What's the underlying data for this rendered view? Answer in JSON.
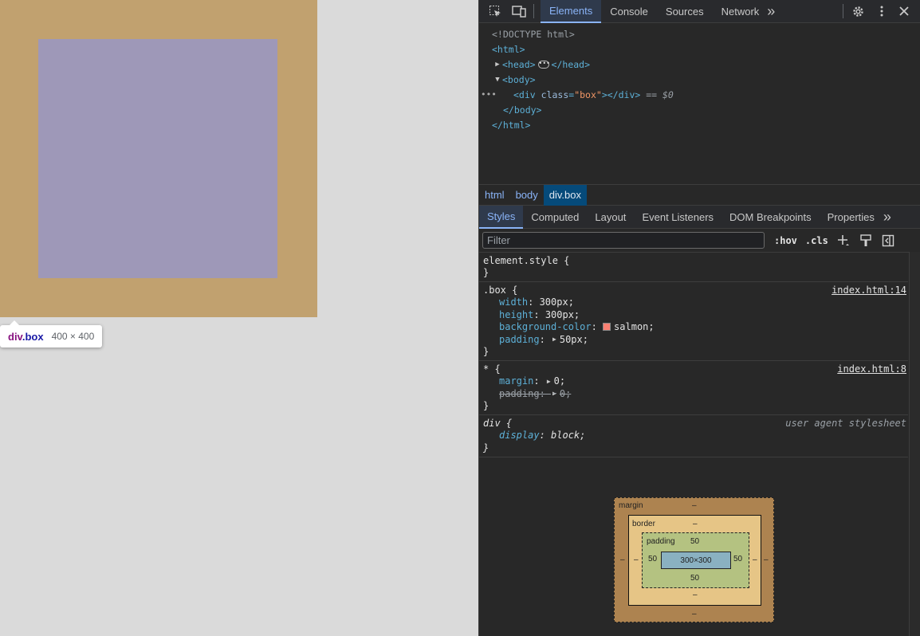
{
  "page": {
    "tooltip": {
      "tag": "div",
      "class_name": ".box",
      "size": "400 × 400"
    }
  },
  "devtools": {
    "toolbar": {
      "tabs": [
        "Elements",
        "Console",
        "Sources",
        "Network"
      ],
      "active_tab": "Elements",
      "more_tabs": "»"
    },
    "dom": {
      "doctype": "<!DOCTYPE html>",
      "html_open": "<html>",
      "head_open": "<head>",
      "head_close": "</head>",
      "body_open": "<body>",
      "div_open": "<div",
      "div_attr": "class",
      "div_attr_val": "\"box\"",
      "div_close": "></div>",
      "selected_marker": "== $0",
      "body_close": "</body>",
      "html_close": "</html>",
      "row_ellipsis": "•••"
    },
    "breadcrumbs": [
      "html",
      "body",
      "div.box"
    ],
    "subtabs": [
      "Styles",
      "Computed",
      "Layout",
      "Event Listeners",
      "DOM Breakpoints",
      "Properties"
    ],
    "filter": {
      "placeholder": "Filter",
      "hov": ":hov",
      "cls": ".cls"
    },
    "rules": {
      "element_style": {
        "selector": "element.style {",
        "close": "}"
      },
      "box": {
        "selector": ".box {",
        "source": "index.html:14",
        "decls": [
          {
            "prop": "width",
            "value": "300px;"
          },
          {
            "prop": "height",
            "value": "300px;"
          },
          {
            "prop": "background-color",
            "value": "salmon;"
          },
          {
            "prop": "padding",
            "value": "50px;"
          }
        ],
        "close": "}"
      },
      "universal": {
        "selector": "* {",
        "source": "index.html:8",
        "decls": [
          {
            "prop": "margin",
            "value": "0;"
          },
          {
            "prop": "padding",
            "value": "0;"
          }
        ],
        "close": "}"
      },
      "div": {
        "selector": "div {",
        "source": "user agent stylesheet",
        "decls": [
          {
            "prop": "display",
            "value": "block;"
          }
        ],
        "close": "}"
      }
    },
    "box_model": {
      "margin_label": "margin",
      "border_label": "border",
      "padding_label": "padding",
      "margin_top": "–",
      "margin_bottom": "–",
      "margin_left": "–",
      "margin_right": "–",
      "border_top": "–",
      "border_bottom": "–",
      "border_left": "–",
      "border_right": "–",
      "padding_top": "50",
      "padding_bottom": "50",
      "padding_left": "50",
      "padding_right": "50",
      "content": "300×300"
    },
    "colors": {
      "swatch": "#fa8072",
      "accent": "#8ab4f8"
    }
  }
}
